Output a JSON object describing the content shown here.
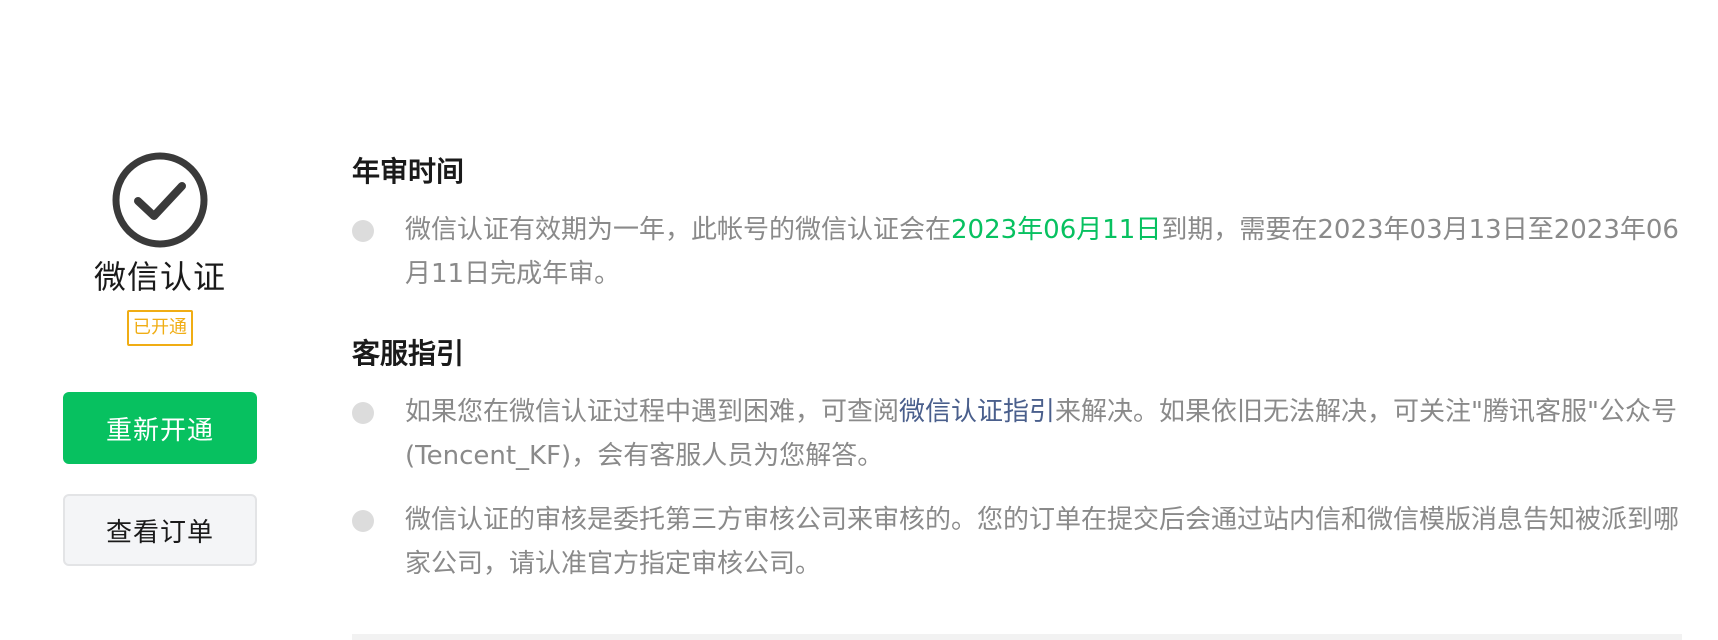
{
  "status": {
    "icon": "check-circle-icon",
    "title": "微信认证",
    "badge": "已开通",
    "primary_button": "重新开通",
    "secondary_button": "查看订单",
    "colors": {
      "icon": "#3a3a3a",
      "badge": "#f0ad14",
      "primary": "#07c160"
    }
  },
  "annual_review": {
    "title": "年审时间",
    "text_before": "微信认证有效期为一年，此帐号的微信认证会在",
    "expiry_date": "2023年06月11日",
    "text_after": "到期，需要在2023年03月13日至2023年06月11日完成年审。",
    "highlight_color": "#07c160"
  },
  "support_guide": {
    "title": "客服指引",
    "item1_before": "如果您在微信认证过程中遇到困难，可查阅",
    "item1_link": "微信认证指引",
    "item1_after": "来解决。如果依旧无法解决，可关注\"腾讯客服\"公众号(Tencent_KF)，会有客服人员为您解答。",
    "item2": "微信认证的审核是委托第三方审核公司来审核的。您的订单在提交后会通过站内信和微信模版消息告知被派到哪家公司，请认准官方指定审核公司。",
    "link_color": "#4a5f8c"
  }
}
